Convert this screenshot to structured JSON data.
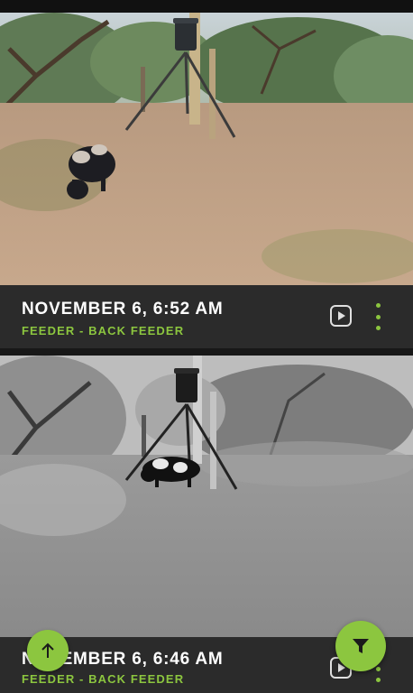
{
  "cards": [
    {
      "date": "NOVEMBER 6, 6:52 AM",
      "location": "FEEDER - BACK FEEDER",
      "image": "color daytime trail camera photo of a spotted hog near a tripod feeder"
    },
    {
      "date": "NOVEMBER 6, 6:46 AM",
      "location": "FEEDER - BACK FEEDER",
      "image": "black and white infrared trail camera photo of a spotted hog under a tripod feeder"
    }
  ],
  "icons": {
    "play": "play-icon",
    "more": "more-vertical-icon",
    "scroll_up": "arrow-up-icon",
    "filter": "filter-icon"
  },
  "colors": {
    "accent": "#8cc63f",
    "bar_bg": "#2b2b2b",
    "text": "#ffffff"
  }
}
